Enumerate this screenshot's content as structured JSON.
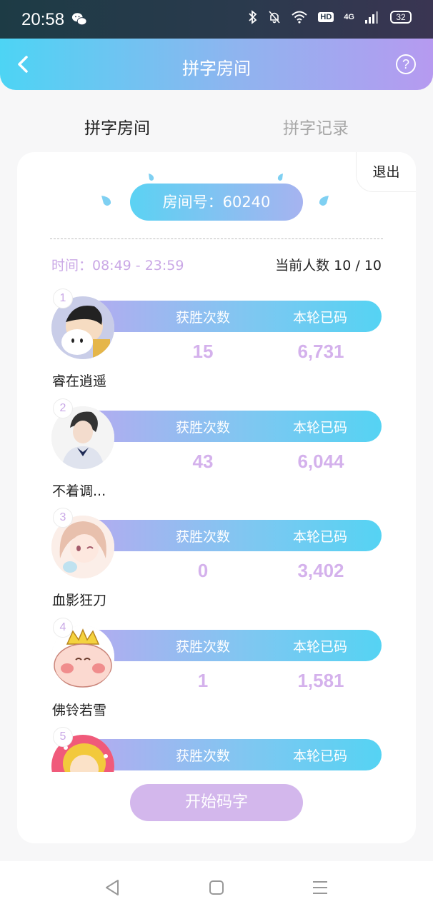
{
  "status": {
    "time": "20:58",
    "battery": "32",
    "hd": "HD",
    "network": "4G"
  },
  "header": {
    "title": "拼字房间"
  },
  "tabs": [
    {
      "label": "拼字房间"
    },
    {
      "label": "拼字记录"
    }
  ],
  "room": {
    "exit_label": "退出",
    "room_number": "房间号：60240",
    "time": "时间：08:49 - 23:59",
    "count": "当前人数 10 / 10"
  },
  "players": [
    {
      "rank": "1",
      "name": "睿在逍遥",
      "wins_label": "获胜次数",
      "typed_label": "本轮已码",
      "wins": "15",
      "typed": "6,731"
    },
    {
      "rank": "2",
      "name": "不着调...",
      "wins_label": "获胜次数",
      "typed_label": "本轮已码",
      "wins": "43",
      "typed": "6,044"
    },
    {
      "rank": "3",
      "name": "血影狂刀",
      "wins_label": "获胜次数",
      "typed_label": "本轮已码",
      "wins": "0",
      "typed": "3,402"
    },
    {
      "rank": "4",
      "name": "佛铃若雪",
      "wins_label": "获胜次数",
      "typed_label": "本轮已码",
      "wins": "1",
      "typed": "1,581"
    },
    {
      "rank": "5",
      "name": "",
      "wins_label": "获胜次数",
      "typed_label": "本轮已码",
      "wins": "",
      "typed": ""
    }
  ],
  "actions": {
    "start_label": "开始码字"
  },
  "colors": {
    "accent_cyan": "#4dd4f4",
    "accent_purple": "#b69af0",
    "value_color": "#d4b1ec",
    "button_purple": "#d3b7ec"
  }
}
